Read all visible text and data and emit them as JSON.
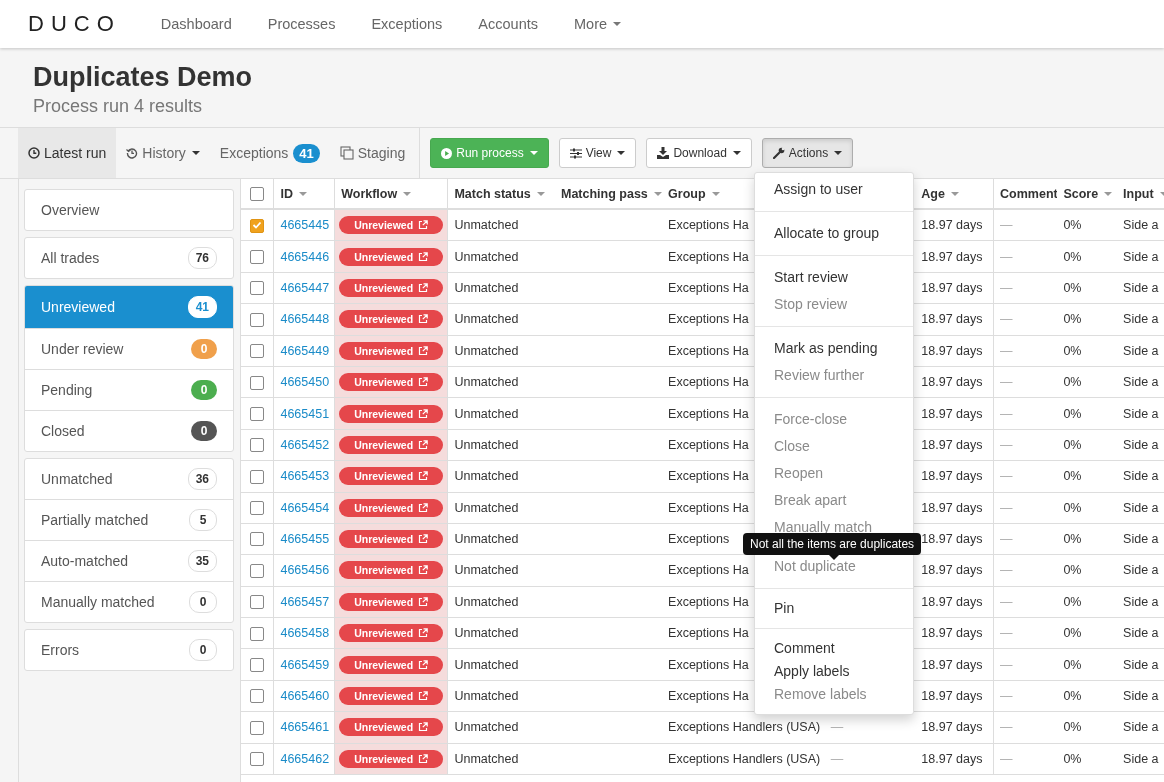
{
  "nav": {
    "logo": "DUCO",
    "items": [
      {
        "label": "Dashboard",
        "dropdown": false
      },
      {
        "label": "Processes",
        "dropdown": false
      },
      {
        "label": "Exceptions",
        "dropdown": false
      },
      {
        "label": "Accounts",
        "dropdown": false
      },
      {
        "label": "More",
        "dropdown": true
      }
    ]
  },
  "page": {
    "title": "Duplicates Demo",
    "subtitle": "Process run 4 results"
  },
  "toolbar": {
    "tabs": [
      {
        "label": "Latest run",
        "selected": true
      },
      {
        "label": "History",
        "selected": false
      },
      {
        "label": "Exceptions",
        "badge": "41",
        "selected": false
      },
      {
        "label": "Staging",
        "selected": false
      }
    ],
    "buttons": [
      {
        "label": "Run process",
        "kind": "primary",
        "open": false
      },
      {
        "label": "View",
        "kind": "default",
        "open": false
      },
      {
        "label": "Download",
        "kind": "default",
        "open": false
      },
      {
        "label": "Actions",
        "kind": "default",
        "open": true
      }
    ]
  },
  "sidebar": {
    "groups": [
      [
        {
          "label": "Overview",
          "selected": false
        }
      ],
      [
        {
          "label": "All trades",
          "count": "76",
          "selected": false
        }
      ],
      [
        {
          "label": "Unreviewed",
          "count": "41",
          "selected": true
        },
        {
          "label": "Under review",
          "count": "0",
          "color": "#f0a04b",
          "selected": false
        },
        {
          "label": "Pending",
          "count": "0",
          "color": "#4cae4f",
          "selected": false
        },
        {
          "label": "Closed",
          "count": "0",
          "color": "#555555",
          "selected": false
        }
      ],
      [
        {
          "label": "Unmatched",
          "count": "36",
          "selected": false
        },
        {
          "label": "Partially matched",
          "count": "5",
          "selected": false
        },
        {
          "label": "Auto-matched",
          "count": "35",
          "selected": false
        },
        {
          "label": "Manually matched",
          "count": "0",
          "selected": false
        }
      ],
      [
        {
          "label": "Errors",
          "count": "0",
          "selected": false
        }
      ]
    ]
  },
  "table": {
    "all_checked": false,
    "columns": [
      {
        "label": "ID",
        "sortable": true
      },
      {
        "label": "Workflow",
        "sortable": true
      },
      {
        "label": "Match status",
        "sortable": true
      },
      {
        "label": "Matching pass",
        "sortable": true
      },
      {
        "label": "Group",
        "sortable": true
      },
      {
        "label": "Age",
        "sortable": true
      },
      {
        "label": "Comment",
        "sortable": false
      },
      {
        "label": "Score",
        "sortable": true
      },
      {
        "label": "Input",
        "sortable": true
      }
    ],
    "rows": [
      {
        "id": "4665445",
        "checked": true,
        "workflow": "Unreviewed",
        "match_status": "Unmatched",
        "group": "Exceptions Ha",
        "age": "18.97 days",
        "comment": "—",
        "score": "0%",
        "input": "Side a"
      },
      {
        "id": "4665446",
        "checked": false,
        "workflow": "Unreviewed",
        "match_status": "Unmatched",
        "group": "Exceptions Ha",
        "age": "18.97 days",
        "comment": "—",
        "score": "0%",
        "input": "Side a"
      },
      {
        "id": "4665447",
        "checked": false,
        "workflow": "Unreviewed",
        "match_status": "Unmatched",
        "group": "Exceptions Ha",
        "age": "18.97 days",
        "comment": "—",
        "score": "0%",
        "input": "Side a"
      },
      {
        "id": "4665448",
        "checked": false,
        "workflow": "Unreviewed",
        "match_status": "Unmatched",
        "group": "Exceptions Ha",
        "age": "18.97 days",
        "comment": "—",
        "score": "0%",
        "input": "Side a"
      },
      {
        "id": "4665449",
        "checked": false,
        "workflow": "Unreviewed",
        "match_status": "Unmatched",
        "group": "Exceptions Ha",
        "age": "18.97 days",
        "comment": "—",
        "score": "0%",
        "input": "Side a"
      },
      {
        "id": "4665450",
        "checked": false,
        "workflow": "Unreviewed",
        "match_status": "Unmatched",
        "group": "Exceptions Ha",
        "age": "18.97 days",
        "comment": "—",
        "score": "0%",
        "input": "Side a"
      },
      {
        "id": "4665451",
        "checked": false,
        "workflow": "Unreviewed",
        "match_status": "Unmatched",
        "group": "Exceptions Ha",
        "age": "18.97 days",
        "comment": "—",
        "score": "0%",
        "input": "Side a"
      },
      {
        "id": "4665452",
        "checked": false,
        "workflow": "Unreviewed",
        "match_status": "Unmatched",
        "group": "Exceptions Ha",
        "age": "18.97 days",
        "comment": "—",
        "score": "0%",
        "input": "Side a"
      },
      {
        "id": "4665453",
        "checked": false,
        "workflow": "Unreviewed",
        "match_status": "Unmatched",
        "group": "Exceptions Ha",
        "age": "18.97 days",
        "comment": "—",
        "score": "0%",
        "input": "Side a"
      },
      {
        "id": "4665454",
        "checked": false,
        "workflow": "Unreviewed",
        "match_status": "Unmatched",
        "group": "Exceptions Ha",
        "age": "18.97 days",
        "comment": "—",
        "score": "0%",
        "input": "Side a"
      },
      {
        "id": "4665455",
        "checked": false,
        "workflow": "Unreviewed",
        "match_status": "Unmatched",
        "group": "Exceptions",
        "age": "18.97 days",
        "comment": "—",
        "score": "0%",
        "input": "Side a"
      },
      {
        "id": "4665456",
        "checked": false,
        "workflow": "Unreviewed",
        "match_status": "Unmatched",
        "group": "Exceptions Ha",
        "age": "18.97 days",
        "comment": "—",
        "score": "0%",
        "input": "Side a"
      },
      {
        "id": "4665457",
        "checked": false,
        "workflow": "Unreviewed",
        "match_status": "Unmatched",
        "group": "Exceptions Ha",
        "age": "18.97 days",
        "comment": "—",
        "score": "0%",
        "input": "Side a"
      },
      {
        "id": "4665458",
        "checked": false,
        "workflow": "Unreviewed",
        "match_status": "Unmatched",
        "group": "Exceptions Ha",
        "age": "18.97 days",
        "comment": "—",
        "score": "0%",
        "input": "Side a"
      },
      {
        "id": "4665459",
        "checked": false,
        "workflow": "Unreviewed",
        "match_status": "Unmatched",
        "group": "Exceptions Ha",
        "age": "18.97 days",
        "comment": "—",
        "score": "0%",
        "input": "Side a"
      },
      {
        "id": "4665460",
        "checked": false,
        "workflow": "Unreviewed",
        "match_status": "Unmatched",
        "group": "Exceptions Ha",
        "age": "18.97 days",
        "comment": "—",
        "score": "0%",
        "input": "Side a"
      },
      {
        "id": "4665461",
        "checked": false,
        "workflow": "Unreviewed",
        "match_status": "Unmatched",
        "group": "Exceptions Handlers (USA)",
        "column_7": "—",
        "age": "18.97 days",
        "comment": "—",
        "score": "0%",
        "input": "Side a"
      },
      {
        "id": "4665462",
        "checked": false,
        "workflow": "Unreviewed",
        "match_status": "Unmatched",
        "group": "Exceptions Handlers (USA)",
        "column_7": "—",
        "age": "18.97 days",
        "comment": "—",
        "score": "0%",
        "input": "Side a"
      }
    ]
  },
  "actions_menu": {
    "groups": [
      [
        {
          "label": "Assign to user",
          "disabled": false
        }
      ],
      [
        {
          "label": "Allocate to group",
          "disabled": false
        }
      ],
      [
        {
          "label": "Start review",
          "disabled": false
        },
        {
          "label": "Stop review",
          "disabled": true
        }
      ],
      [
        {
          "label": "Mark as pending",
          "disabled": false
        },
        {
          "label": "Review further",
          "disabled": true
        }
      ],
      [
        {
          "label": "Force-close",
          "disabled": true
        },
        {
          "label": "Close",
          "disabled": true
        },
        {
          "label": "Reopen",
          "disabled": true
        },
        {
          "label": "Break apart",
          "disabled": true
        },
        {
          "label": "Manually match",
          "disabled": true
        },
        {
          "label": "Not duplicate",
          "disabled": true,
          "tooltip": "Not all the items are duplicates"
        }
      ],
      [
        {
          "label": "Pin",
          "disabled": false
        }
      ],
      [
        {
          "label": "Comment",
          "disabled": false
        },
        {
          "label": "Apply labels",
          "disabled": false
        },
        {
          "label": "Remove labels",
          "disabled": true
        }
      ]
    ]
  }
}
